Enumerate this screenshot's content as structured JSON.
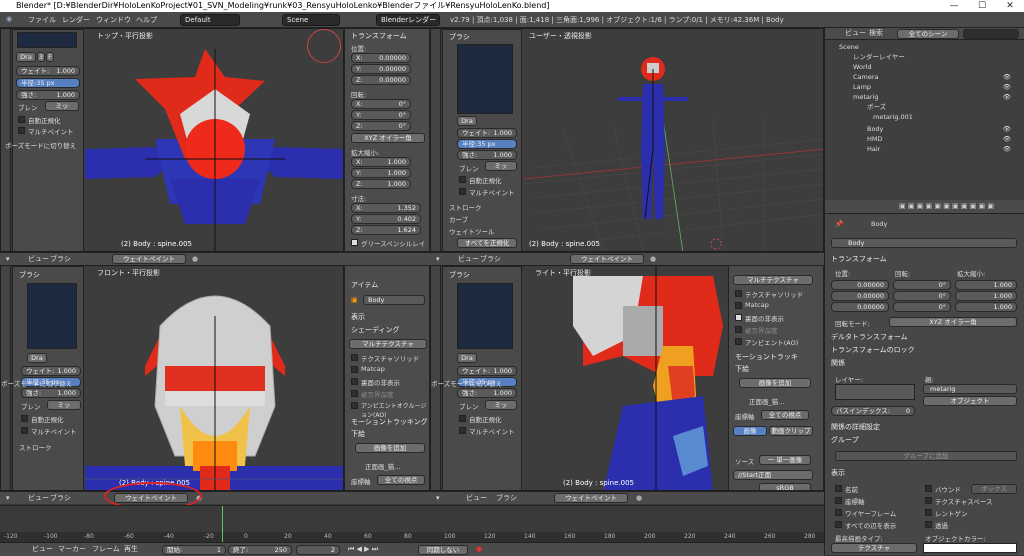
{
  "window": {
    "title": "Blender* [D:¥BlenderDir¥HoloLenKoProject¥01_SVN_Modeling¥runk¥03_RensyuHoloLenko¥Blenderファイル¥RensyuHoloLenKo.blend]",
    "min": "—",
    "max": "☐",
    "close": "✕"
  },
  "infobar": {
    "menus": [
      "ファイル",
      "レンダー",
      "ウィンドウ",
      "ヘルプ"
    ],
    "layout": "Default",
    "scene": "Scene",
    "engine": "Blenderレンダー",
    "stats": "v2.79 | 頂点:1,038 | 面:1,418 | 三角面:1,996 | オブジェクト:1/6 | ランプ:0/1 | メモリ:42.36M | Body"
  },
  "views": {
    "top": {
      "label": "トップ・平行投影",
      "footer": "(2) Body : spine.005"
    },
    "user": {
      "label": "ユーザー・透視投影",
      "footer": "(2) Body : spine.005"
    },
    "front": {
      "label": "フロント・平行投影",
      "footer": "(2) Body : spine.005"
    },
    "right": {
      "label": "ライト・平行投影",
      "footer": "(2) Body : spine.005"
    }
  },
  "header": {
    "view": "ビュー",
    "brush": "ブラシ",
    "mode": "ウェイトペイント"
  },
  "brush_panel": {
    "title": "ブラシ",
    "name": "Dra",
    "num": "3",
    "f": "F",
    "weight_label": "ウェイト:",
    "weight": "1.000",
    "radius_label": "半径:35 px",
    "strength_label": "強さ:",
    "strength": "1.000",
    "blend_label": "ブレン",
    "blend": "ミッ",
    "auto_normalize": "自動正規化",
    "multipaint": "マルチペイント",
    "pose_switch": "ポーズモードに切り替え",
    "stroke": "ストローク",
    "curve": "カーブ",
    "weight_tools": "ウェイトツール",
    "normalize_all": "すべてを正規化"
  },
  "transform_panel": {
    "title": "トランスフォーム",
    "location": "位置:",
    "rotation": "回転:",
    "scale": "拡大縮小:",
    "dimensions": "寸法:",
    "x": "X:",
    "y": "Y:",
    "z": "Z:",
    "loc": [
      "0.00000",
      "0.00000",
      "0.00000"
    ],
    "rot": [
      "0°",
      "0°",
      "0°"
    ],
    "scl": [
      "1.000",
      "1.000",
      "1.000"
    ],
    "dim": [
      "1.352",
      "0.402",
      "1.624"
    ],
    "rotmode": "XYZ オイラー角",
    "grease": "グリースペンシルレイ"
  },
  "front_panel": {
    "item": "アイテム",
    "object": "Body",
    "display": "表示",
    "shading": "シェーディング",
    "multitex": "マルチテクスチャ",
    "texsolid": "テクスチャソリッド",
    "matcap": "Matcap",
    "backface": "裏面の非表示",
    "depth": "被写界深度",
    "ao": "アンビエントオクルージョン(AO)",
    "motion": "モーショントラッキング",
    "bg": "下絵",
    "add_image": "画像を追加",
    "front_img": "正面画_猫...",
    "axis_label": "座標軸",
    "axis": "全ての視点"
  },
  "right_panel": {
    "multitex": "マルチテクスチャ",
    "texsolid": "テクスチャソリッド",
    "matcap": "Matcap",
    "backface": "裏面の非表示",
    "depth": "被写界深度",
    "ao": "アンビエント(AO)",
    "motion": "モーショントラッキ",
    "bg": "下絵",
    "add_image": "画像を追加",
    "img_name": "正面画_猫...",
    "axis_label": "座標軸",
    "axis": "全ての視点",
    "tab_img": "画像",
    "tab_clip": "動画クリップ",
    "source": "ソース",
    "single": "一 単一画像",
    "file": "//Start正面",
    "color": "sRGB"
  },
  "outliner": {
    "view": "ビュー",
    "search": "検索",
    "filter": "全てのシーン",
    "items": [
      "Scene",
      "レンダーレイヤー",
      "World",
      "Camera",
      "Lamp",
      "metarig",
      "ポーズ",
      "metarig.001",
      "Body",
      "HMD",
      "Hair"
    ]
  },
  "properties": {
    "object_name": "Body",
    "breadcrumb": "Body",
    "transform": "トランスフォーム",
    "location": "位置:",
    "rotation": "回転:",
    "scale": "拡大縮小:",
    "loc": [
      "0.00000",
      "0.00000",
      "0.00000"
    ],
    "rot": [
      "0°",
      "0°",
      "0°"
    ],
    "scl": [
      "1.000",
      "1.000",
      "1.000"
    ],
    "rotmode_label": "回転モード:",
    "rotmode": "XYZ オイラー角",
    "delta": "デルタトランスフォーム",
    "lock": "トランスフォームのロック",
    "relations": "関係",
    "layer": "レイヤー:",
    "parent": "親:",
    "parent_val": "metarig",
    "parent_type": "オブジェクト",
    "pass_index": "パスインデックス:",
    "pass_val": "0",
    "relations_extra": "関係の詳細設定",
    "groups": "グループ",
    "add_to_group": "グループに追加",
    "display": "表示",
    "name": "名前",
    "axis": "座標軸",
    "wire": "ワイヤーフレーム",
    "all_edges": "すべての辺を表示",
    "bounds": "バウンド",
    "bounds_type": "ボックス",
    "texspace": "テクスチャスペース",
    "xray": "レントゲン",
    "transp": "透過",
    "maxdraw": "最高描画タイプ:",
    "maxdraw_val": "テクスチャ",
    "objcolor": "オブジェクトカラー:"
  },
  "timeline": {
    "ticks": [
      "-120",
      "-100",
      "-80",
      "-60",
      "-40",
      "-20",
      "0",
      "20",
      "40",
      "60",
      "80",
      "100",
      "120",
      "140",
      "160",
      "180",
      "200",
      "220",
      "240",
      "260",
      "280"
    ],
    "view": "ビュー",
    "marker": "マーカー",
    "frame": "フレーム",
    "play": "再生",
    "start_label": "開始:",
    "start": "1",
    "end_label": "終了:",
    "end": "250",
    "current": "2",
    "sync": "同期しない"
  },
  "colors": {
    "accent": "#5680c2",
    "highlight": "#d22222",
    "blue": "#2b2fae",
    "red": "#e02a1a"
  }
}
